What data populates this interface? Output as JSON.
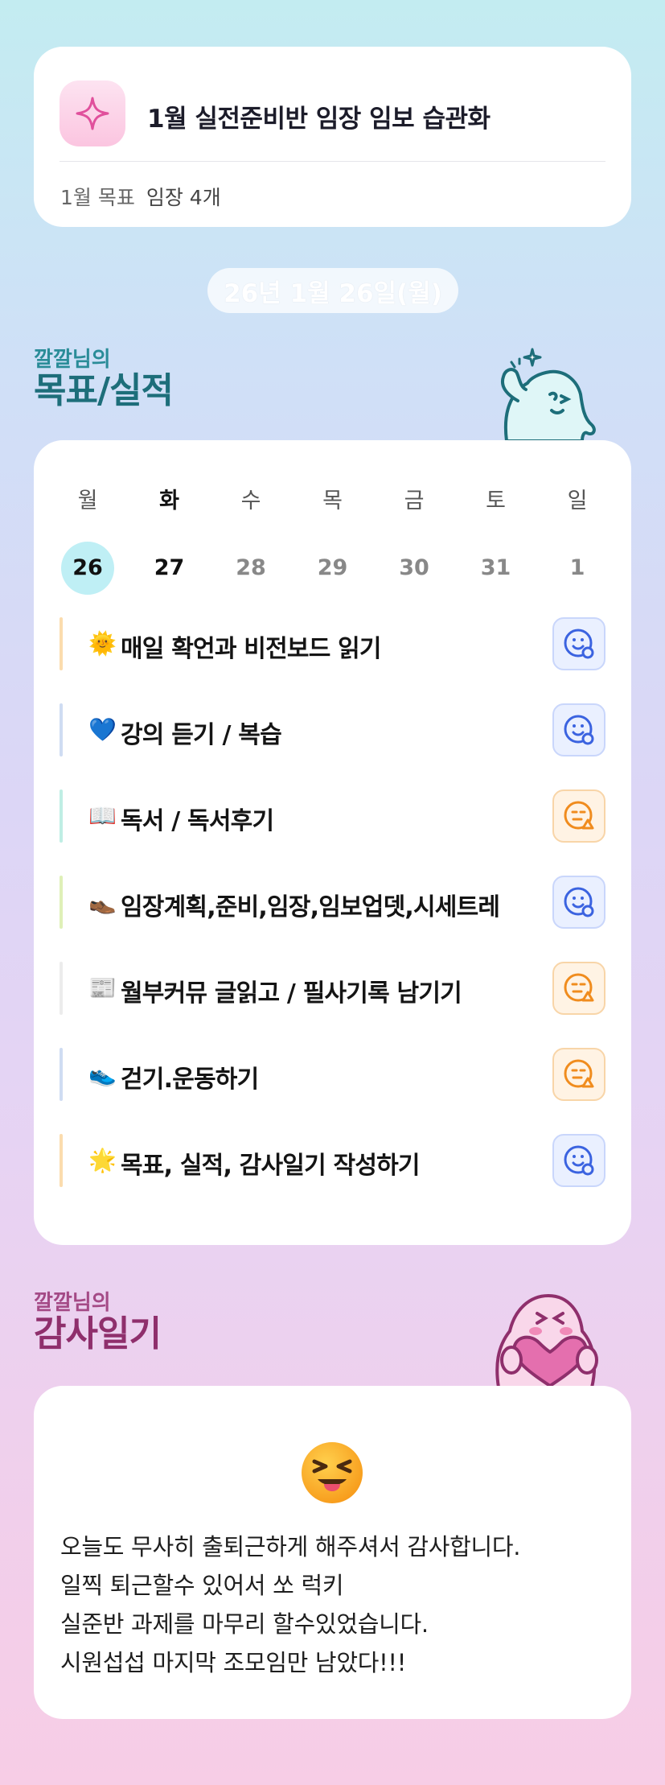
{
  "goal": {
    "icon": "sparkle-icon",
    "title": "1월 실전준비반 임장 임보 습관화",
    "meta_label": "1월 목표",
    "meta_value": "임장 4개"
  },
  "date_pill": "26년 1월 26일(월)",
  "goals_section": {
    "owner": "깔깔님의",
    "title": "목표/실적"
  },
  "week": {
    "days": [
      "월",
      "화",
      "수",
      "목",
      "금",
      "토",
      "일"
    ],
    "dates": [
      "26",
      "27",
      "28",
      "29",
      "30",
      "31",
      "1"
    ],
    "selected_index": 0
  },
  "tasks": [
    {
      "emoji": "🌞",
      "label": "매일 확언과 비전보드 읽기",
      "bar_color": "#fbdcae",
      "status": "good"
    },
    {
      "emoji": "💙",
      "label": "강의 듣기 / 복습",
      "bar_color": "#cfdcf2",
      "status": "good"
    },
    {
      "emoji": "📖",
      "label": "독서 / 독서후기",
      "bar_color": "#bfeee4",
      "status": "warn"
    },
    {
      "emoji": "👞",
      "label": "임장계획,준비,임장,임보업뎃,시세트레",
      "bar_color": "#dff0b8",
      "status": "good"
    },
    {
      "emoji": "📰",
      "label": "월부커뮤 글읽고 / 필사기록 남기기",
      "bar_color": "#ececec",
      "status": "warn"
    },
    {
      "emoji": "👟",
      "label": "걷기.운동하기",
      "bar_color": "#cfdcf2",
      "status": "warn"
    },
    {
      "emoji": "🌟",
      "label": "목표, 실적, 감사일기 작성하기",
      "bar_color": "#fbdcae",
      "status": "good"
    }
  ],
  "thanks_section": {
    "owner": "깔깔님의",
    "title": "감사일기"
  },
  "diary": {
    "emoji": "squinting-face-with-tongue",
    "lines": [
      "오늘도 무사히 출퇴근하게 해주셔서 감사합니다.",
      "일찍 퇴근할수 있어서 쏘 럭키",
      "실준반 과제를 마무리 할수있었습니다.",
      "시원섭섭 마지막 조모임만 남았다!!!"
    ]
  },
  "colors": {
    "good": "#3b63e0",
    "warn": "#f08c1e",
    "today": "#bfeff5"
  }
}
